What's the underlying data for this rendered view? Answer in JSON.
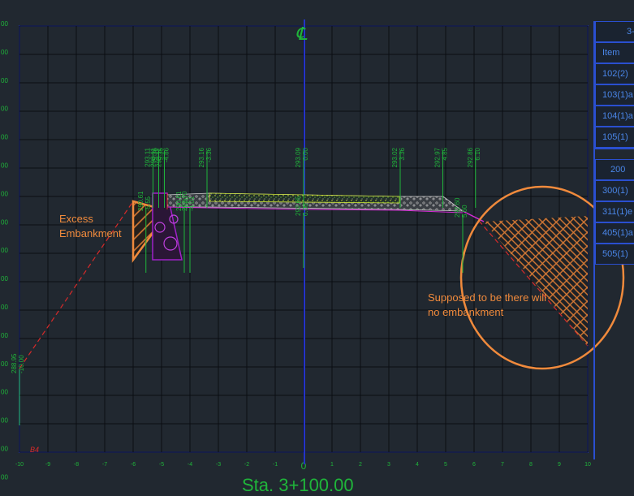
{
  "centerline_mark": "℄",
  "station_label": "Sta. 3+100.00",
  "x_axis_ticks": [
    "-10",
    "-9",
    "-8",
    "-7",
    "-6",
    "-5",
    "-4",
    "-3",
    "-2",
    "-1",
    "0",
    "1",
    "2",
    "3",
    "4",
    "5",
    "6",
    "7",
    "8",
    "9",
    "10"
  ],
  "y_axis_ticks": [
    "00",
    "00",
    "00",
    "00",
    "00",
    "00",
    "00",
    "00",
    "00",
    "00",
    "00",
    "00",
    "00",
    "00",
    "00",
    "00",
    "00"
  ],
  "annotations": {
    "excess": "Excess\nEmbankment",
    "supposed": "Supposed to be there will\nno embankment"
  },
  "elevation_labels": [
    {
      "offset": -5.3,
      "elev": "293.11",
      "off": "-5.36"
    },
    {
      "offset": -5.1,
      "elev": "293.11",
      "off": "-5.35"
    },
    {
      "offset": -4.9,
      "elev": "293.11",
      "off": "-4.86"
    },
    {
      "offset": -3.4,
      "elev": "293.16",
      "off": "-3.36"
    },
    {
      "offset": 0,
      "elev": "293.09",
      "off": "0.00"
    },
    {
      "offset": 3.4,
      "elev": "293.02",
      "off": "3.36"
    },
    {
      "offset": 4.9,
      "elev": "292.97",
      "off": "4.85"
    },
    {
      "offset": 6.05,
      "elev": "292.86",
      "off": "6.10"
    }
  ],
  "lower_labels": [
    {
      "offset": -5.55,
      "elev": "290.61",
      "off": "-5.55"
    },
    {
      "offset": -4.2,
      "elev": "290.61",
      "off": "-4.20"
    },
    {
      "offset": -4.0,
      "elev": "292.70",
      "off": "-4.01"
    },
    {
      "offset": 0,
      "elev": "292.65",
      "off": "0.00"
    },
    {
      "offset": 5.6,
      "elev": "292.60",
      "off": "5.60"
    },
    {
      "offset": -10,
      "elev": "288.95",
      "off": "-10.00"
    }
  ],
  "corner_mark": "B4",
  "table": {
    "header": "3-",
    "rows1": [
      "Item",
      "102(2)",
      "103(1)a",
      "104(1)a",
      "105(1)"
    ],
    "rows2": [
      "200",
      "300(1)",
      "311(1)e",
      "405(1)a",
      "505(1)"
    ]
  },
  "colors": {
    "background": "#212830",
    "grid": "#0b0e12",
    "centerline": "#2433c8",
    "text_green": "#1fb53a",
    "annotation": "#f08a3c",
    "daylight": "#d62a2a",
    "pavement": "#e6e6e6",
    "structure": "#a020c8"
  }
}
